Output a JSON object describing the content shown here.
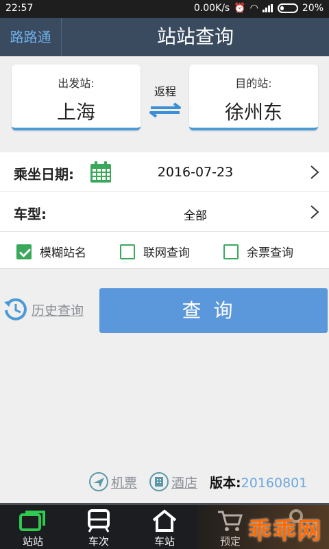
{
  "status": {
    "time": "22:57",
    "speed": "0.00K/s",
    "battery": "20%"
  },
  "header": {
    "brand": "路路通",
    "title": "站站查询"
  },
  "stations": {
    "from_label": "出发站:",
    "from_value": "上海",
    "to_label": "目的站:",
    "to_value": "徐州东",
    "return_label": "返程"
  },
  "form": {
    "date_label": "乘坐日期:",
    "date_value": "2016-07-23",
    "type_label": "车型:",
    "type_value": "全部",
    "checks": [
      {
        "label": "模糊站名",
        "checked": true
      },
      {
        "label": "联网查询",
        "checked": false
      },
      {
        "label": "余票查询",
        "checked": false
      }
    ]
  },
  "history_label": "历史查询",
  "query_button": "查询",
  "links": {
    "flight": "机票",
    "hotel": "酒店",
    "version_label": "版本:",
    "version_value": "20160801"
  },
  "tabs": [
    {
      "label": "站站",
      "icon": "station-to-station-icon",
      "active": true
    },
    {
      "label": "车次",
      "icon": "train-icon",
      "active": false
    },
    {
      "label": "车站",
      "icon": "station-house-icon",
      "active": false
    },
    {
      "label": "预定",
      "icon": "cart-icon",
      "active": false
    },
    {
      "label": "",
      "icon": "more-icon",
      "active": false
    }
  ],
  "watermark": "乖乖网",
  "colors": {
    "header": "#3a4a5f",
    "accent": "#5b97db",
    "green": "#3aa85a"
  }
}
